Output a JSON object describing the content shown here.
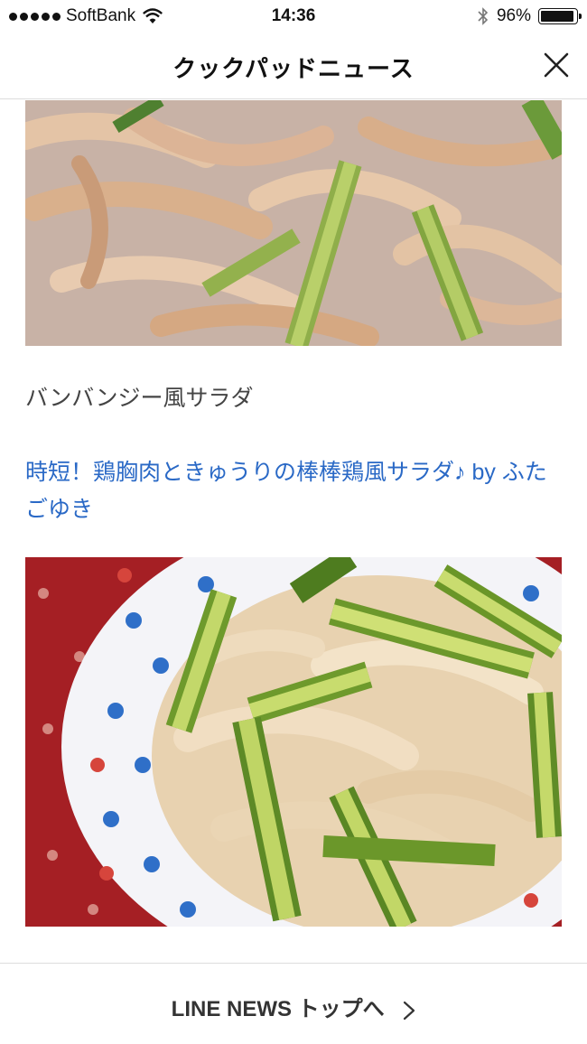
{
  "status_bar": {
    "carrier": "SoftBank",
    "time": "14:36",
    "battery_percent": "96%",
    "battery_level": 0.96
  },
  "nav": {
    "title": "クックパッドニュース",
    "close_icon": "close-icon"
  },
  "article": {
    "caption": "バンバンジー風サラダ",
    "recipe_link": "時短！鶏胸肉ときゅうりの棒棒鶏風サラダ♪ by ふたごゆき"
  },
  "footer": {
    "label": "LINE NEWS トップへ",
    "chevron_icon": "chevron-right-icon"
  },
  "colors": {
    "link": "#2a69c6",
    "text": "#444444"
  }
}
